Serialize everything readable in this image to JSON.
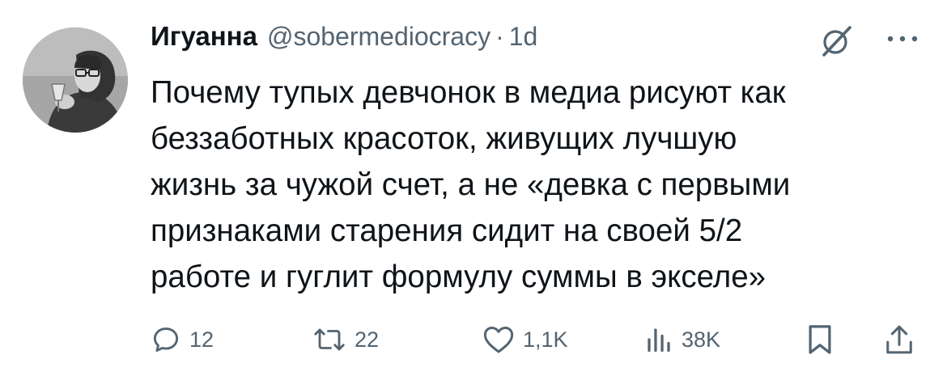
{
  "author": {
    "name": "Игуанна",
    "handle": "@sobermediocracy",
    "separator": "·",
    "time": "1d"
  },
  "post": {
    "text": "Почему тупых девчонок в медиа рисуют как\nбеззаботных красоток, живущих лучшую\nжизнь за чужой счет, а не «девка с первыми\nпризнаками старения сидит на своей 5/2\nработе и гуглит формулу суммы в экселе»"
  },
  "stats": {
    "replies": "12",
    "reposts": "22",
    "likes": "1,1K",
    "views": "38K"
  },
  "icons": {
    "reply": "reply-icon",
    "repost": "repost-icon",
    "like": "heart-icon",
    "views": "views-icon",
    "bookmark": "bookmark-icon",
    "share": "share-icon",
    "grok": "grok-icon",
    "more": "more-icon"
  },
  "colors": {
    "text": "#0f1419",
    "secondary": "#536471",
    "background": "#ffffff"
  }
}
